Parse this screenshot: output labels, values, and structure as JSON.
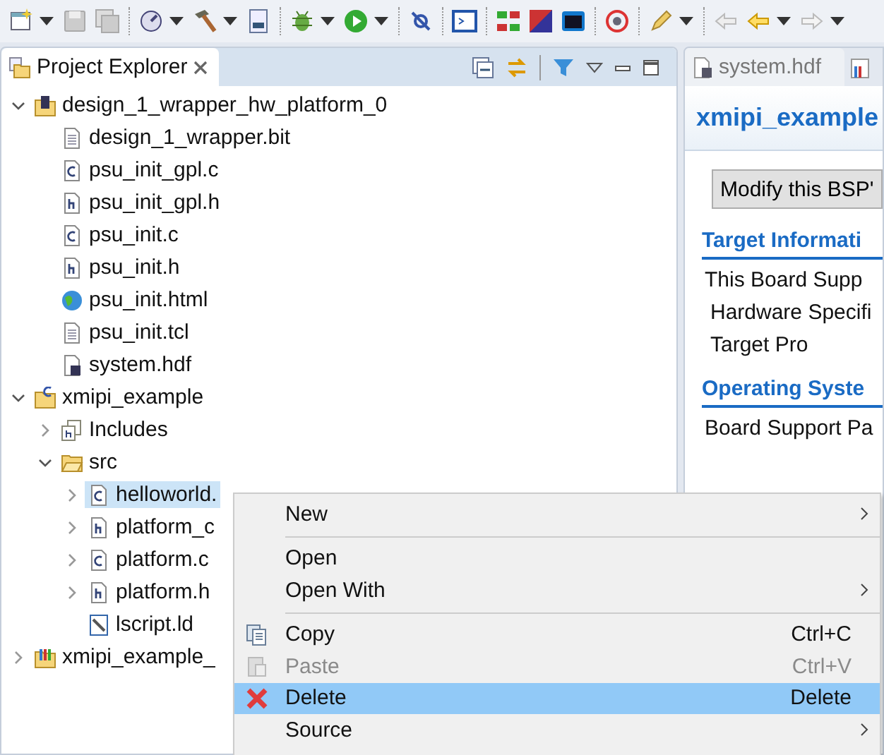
{
  "explorer": {
    "title": "Project Explorer"
  },
  "tree": [
    {
      "label": "design_1_wrapper_hw_platform_0",
      "kind": "hw-project",
      "expanded": true,
      "selected": false,
      "children": [
        {
          "label": "design_1_wrapper.bit",
          "kind": "text-file",
          "selected": false
        },
        {
          "label": "psu_init_gpl.c",
          "kind": "c-file",
          "selected": false
        },
        {
          "label": "psu_init_gpl.h",
          "kind": "h-file",
          "selected": false
        },
        {
          "label": "psu_init.c",
          "kind": "c-file",
          "selected": false
        },
        {
          "label": "psu_init.h",
          "kind": "h-file",
          "selected": false
        },
        {
          "label": "psu_init.html",
          "kind": "web-file",
          "selected": false
        },
        {
          "label": "psu_init.tcl",
          "kind": "text-file",
          "selected": false
        },
        {
          "label": "system.hdf",
          "kind": "hdf-file",
          "selected": false
        }
      ]
    },
    {
      "label": "xmipi_example",
      "kind": "c-project",
      "expanded": true,
      "selected": false,
      "children": [
        {
          "label": "Includes",
          "kind": "includes",
          "expanded": false,
          "selected": false
        },
        {
          "label": "src",
          "kind": "folder",
          "expanded": true,
          "selected": false,
          "children": [
            {
              "label": "helloworld.",
              "kind": "c-source",
              "expanded": false,
              "selected": true
            },
            {
              "label": "platform_c",
              "kind": "h-source",
              "expanded": false,
              "selected": false
            },
            {
              "label": "platform.c",
              "kind": "c-source",
              "expanded": false,
              "selected": false
            },
            {
              "label": "platform.h",
              "kind": "h-source",
              "expanded": false,
              "selected": false
            },
            {
              "label": "lscript.ld",
              "kind": "linker-file",
              "selected": false
            }
          ]
        }
      ]
    },
    {
      "label": "xmipi_example_",
      "kind": "bsp-project",
      "expanded": false,
      "selected": false
    }
  ],
  "editor": {
    "tabs": [
      {
        "label": "system.hdf",
        "selected": false
      }
    ],
    "title": "xmipi_example",
    "button": "Modify this BSP'",
    "sections": [
      {
        "heading": "Target Informati",
        "lines": [
          {
            "text": "This Board Supp",
            "indent": false
          },
          {
            "text": "Hardware Specifi",
            "indent": true
          },
          {
            "text": "Target Pro",
            "indent": true
          }
        ]
      },
      {
        "heading": "Operating Syste",
        "lines": [
          {
            "text": "Board Support Pa",
            "indent": false
          }
        ]
      }
    ]
  },
  "context_menu": [
    {
      "kind": "plain",
      "label": "New",
      "submenu": true,
      "disabled": false,
      "selected": false
    },
    {
      "kind": "separator"
    },
    {
      "kind": "plain",
      "label": "Open",
      "submenu": false,
      "disabled": false,
      "selected": false
    },
    {
      "kind": "plain",
      "label": "Open With",
      "submenu": true,
      "disabled": false,
      "selected": false
    },
    {
      "kind": "separator"
    },
    {
      "kind": "copy",
      "label": "Copy",
      "shortcut": "Ctrl+C",
      "submenu": false,
      "disabled": false,
      "selected": false
    },
    {
      "kind": "paste",
      "label": "Paste",
      "shortcut": "Ctrl+V",
      "submenu": false,
      "disabled": true,
      "selected": false
    },
    {
      "kind": "delete",
      "label": "Delete",
      "shortcut": "Delete",
      "submenu": false,
      "disabled": false,
      "selected": true
    },
    {
      "kind": "plain",
      "label": "Source",
      "submenu": true,
      "disabled": false,
      "selected": false
    }
  ]
}
